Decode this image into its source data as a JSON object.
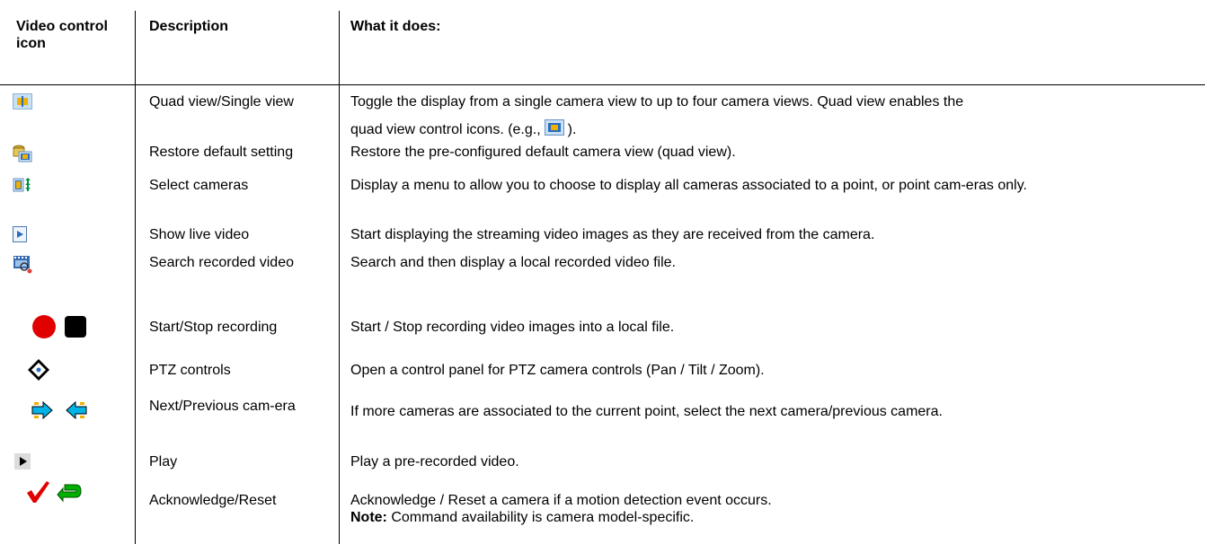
{
  "headers": {
    "icon": "Video control icon",
    "description": "Description",
    "what": "What it does:"
  },
  "rows": [
    {
      "icons": [
        "quad-view-icon"
      ],
      "description": "Quad view/Single view",
      "what_part1": "Toggle the display from a single camera view to up to four camera views. Quad view enables the",
      "what_part2": "quad view control icons. (e.g.,",
      "what_part3": ")."
    },
    {
      "icons": [
        "restore-default-icon"
      ],
      "description": "Restore default setting",
      "what": "Restore the pre-configured default camera view (quad view)."
    },
    {
      "icons": [
        "select-cameras-icon"
      ],
      "description": "Select cameras",
      "what": "Display a menu to allow you to choose to display all cameras associated to a point, or point cam-eras only."
    },
    {
      "icons": [
        "show-live-video-icon"
      ],
      "description": "Show live video",
      "what": "Start displaying the streaming video images as they are received from the camera."
    },
    {
      "icons": [
        "search-recorded-video-icon"
      ],
      "description": "Search recorded video",
      "what": "Search and then display a local recorded video file."
    },
    {
      "icons": [
        "record-start-icon",
        "record-stop-icon"
      ],
      "description": "Start/Stop recording",
      "what": "Start / Stop recording video images into a local file."
    },
    {
      "icons": [
        "ptz-controls-icon"
      ],
      "description": "PTZ controls",
      "what": "Open a control panel for PTZ camera controls (Pan / Tilt / Zoom)."
    },
    {
      "icons": [
        "next-camera-icon",
        "previous-camera-icon"
      ],
      "description": "Next/Previous cam-era",
      "what": "If more cameras are associated to the current point, select the next camera/previous camera."
    },
    {
      "icons": [
        "play-icon"
      ],
      "description": "Play",
      "what": "Play a pre-recorded video."
    },
    {
      "icons": [
        "acknowledge-icon",
        "reset-icon"
      ],
      "description": "Acknowledge/Reset",
      "what": "Acknowledge / Reset a camera if a motion detection event occurs.",
      "note_label": "Note:",
      "note_text": " Command availability is camera model-specific."
    }
  ],
  "colors": {
    "record": "#e00000",
    "quad_blue": "#2a6cc0",
    "quad_yellow": "#f0b000",
    "arrow_cyan": "#00b4e6",
    "check_red": "#e00000",
    "reset_green": "#00a000"
  }
}
